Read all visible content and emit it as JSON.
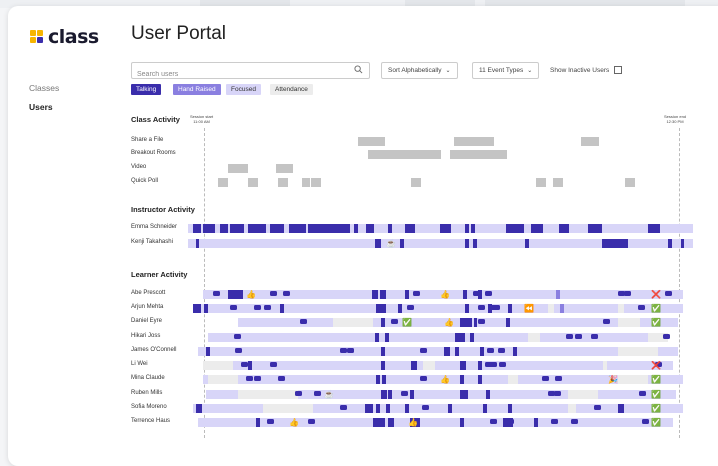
{
  "app": {
    "logo_text": "class",
    "page_title": "User Portal"
  },
  "nav": {
    "items": [
      "Classes",
      "Users"
    ],
    "active": "Users"
  },
  "toolbar": {
    "search_placeholder": "Search users",
    "sort_label": "Sort Alphabetically",
    "event_types_label": "11 Event Types",
    "show_inactive_label": "Show Inactive Users",
    "show_inactive_checked": false
  },
  "legend": [
    {
      "label": "Talking",
      "bg": "#3a2dab",
      "fg": "#ffffff"
    },
    {
      "label": "Hand Raised",
      "bg": "#8a7fe0",
      "fg": "#ffffff"
    },
    {
      "label": "Focused",
      "bg": "#d8d5f8",
      "fg": "#333333"
    },
    {
      "label": "Attendance",
      "bg": "#ececec",
      "fg": "#333333"
    }
  ],
  "session": {
    "start_label": "Session start",
    "start_time": "11:00 AM",
    "end_label": "Session end",
    "end_time": "12:30 PM"
  },
  "sections": {
    "class_activity": "Class Activity",
    "instructor_activity": "Instructor Activity",
    "learner_activity": "Learner Activity"
  },
  "class_rows": [
    "Share a File",
    "Breakout Rooms",
    "Video",
    "Quick Poll"
  ],
  "instructors": [
    "Emma Schneider",
    "Kenji Takahashi"
  ],
  "learners": [
    "Abe Prescott",
    "Arjun Mehta",
    "Daniel Eyre",
    "Hikari Joss",
    "James O'Connell",
    "Li Wei",
    "Mina Claude",
    "Ruben Mills",
    "Sofia Moreno",
    "Terrence Haus"
  ],
  "status": {
    "Abe Prescott": "cross",
    "Arjun Mehta": "check",
    "Daniel Eyre": "check",
    "Hikari Joss": "",
    "James O'Connell": "",
    "Li Wei": "cross",
    "Mina Claude": "check",
    "Ruben Mills": "check",
    "Sofia Moreno": "check",
    "Terrence Haus": "check"
  },
  "icons": [
    "search-icon",
    "chevron-down-icon",
    "checkbox-icon",
    "speech-bubble-icon",
    "thumbs-up-icon",
    "coffee-icon",
    "party-icon",
    "rewind-icon",
    "check-icon",
    "cross-icon"
  ],
  "colors": {
    "talking": "#3a2dab",
    "hand_raised": "#8a7fe0",
    "focused": "#d8d5f8",
    "attendance": "#ececec",
    "class_event": "#c4c4c4",
    "check": "#22b14c",
    "cross": "#e0252b"
  }
}
